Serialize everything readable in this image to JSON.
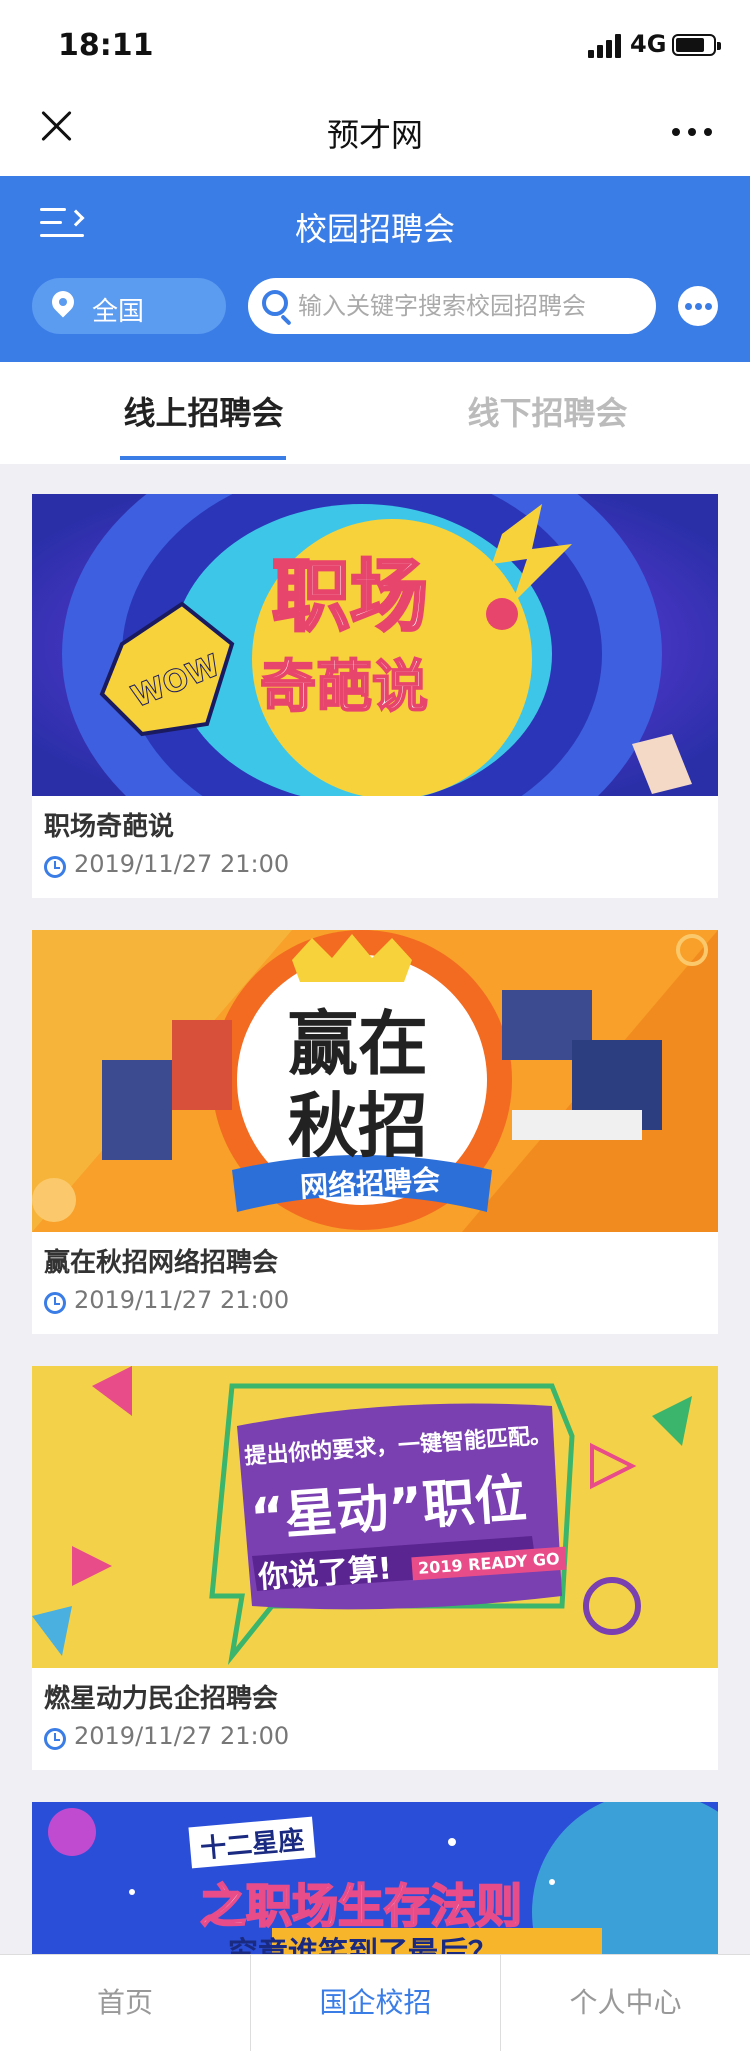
{
  "status": {
    "time": "18:11",
    "network": "4G"
  },
  "nav": {
    "title": "预才网"
  },
  "header": {
    "title": "校园招聘会"
  },
  "region": {
    "label": "全国"
  },
  "search": {
    "placeholder": "输入关键字搜索校园招聘会"
  },
  "tabs": [
    {
      "label": "线上招聘会",
      "active": true
    },
    {
      "label": "线下招聘会",
      "active": false
    }
  ],
  "cards": [
    {
      "title": "职场奇葩说",
      "time": "2019/11/27 21:00",
      "banner": {
        "line1": "职场",
        "line2": "奇葩说",
        "badge": "WOW"
      }
    },
    {
      "title": "赢在秋招网络招聘会",
      "time": "2019/11/27 21:00",
      "banner": {
        "line1": "赢在",
        "line2": "秋招",
        "ribbon": "网络招聘会"
      }
    },
    {
      "title": "燃星动力民企招聘会",
      "time": "2019/11/27 21:00",
      "banner": {
        "top": "提出你的要求，一键智能匹配。",
        "main": "“星动”职位",
        "bottom": "你说了算!",
        "tag": "2019 READY GO"
      }
    },
    {
      "title": "",
      "time": "",
      "banner": {
        "line1": "十二星座",
        "line2": "之职场生存法则",
        "line3": "究竟谁笑到了最后？"
      }
    }
  ],
  "bottom_tabs": [
    {
      "label": "首页",
      "active": false
    },
    {
      "label": "国企校招",
      "active": true
    },
    {
      "label": "个人中心",
      "active": false
    }
  ],
  "colors": {
    "primary": "#3b7de6",
    "background": "#efeff4"
  }
}
